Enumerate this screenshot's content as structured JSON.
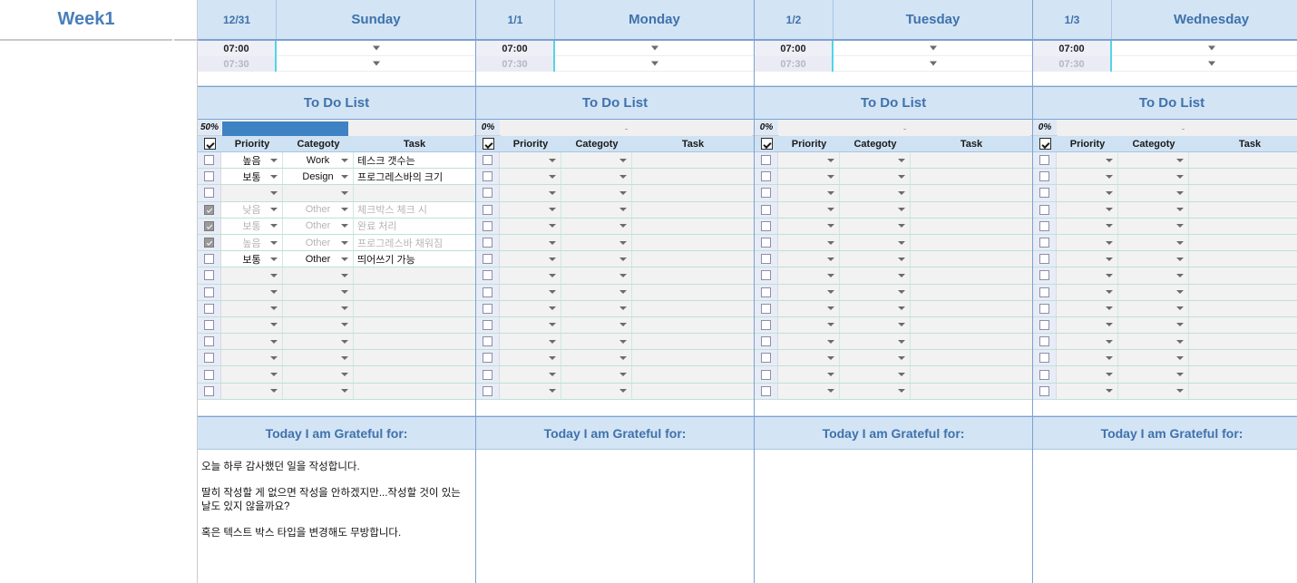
{
  "week": {
    "label": "Week1"
  },
  "columns": {
    "priority_header": "Priority",
    "category_header": "Categoty",
    "task_header": "Task"
  },
  "sections": {
    "todo_title": "To Do List",
    "grateful_title": "Today I am Grateful for:"
  },
  "time_rows": [
    {
      "label": "07:00"
    },
    {
      "label": "07:30"
    }
  ],
  "days": [
    {
      "date": "12/31",
      "name": "Sunday",
      "progress_pct": "50%",
      "progress_value": 50,
      "tasks": [
        {
          "checked": false,
          "priority": "높음",
          "category": "Work",
          "task": "테스크 갯수는",
          "dim": false
        },
        {
          "checked": false,
          "priority": "보통",
          "category": "Design",
          "task": "프로그레스바의 크기",
          "dim": false
        },
        {
          "checked": false,
          "priority": "",
          "category": "",
          "task": "",
          "dim": false
        },
        {
          "checked": true,
          "priority": "낮음",
          "category": "Other",
          "task": "체크박스 체크 시",
          "dim": true
        },
        {
          "checked": true,
          "priority": "보통",
          "category": "Other",
          "task": "완료 처리",
          "dim": true
        },
        {
          "checked": true,
          "priority": "높음",
          "category": "Other",
          "task": "프로그레스바 채워짐",
          "dim": true
        },
        {
          "checked": false,
          "priority": "보통",
          "category": "Other",
          "task": "띄어쓰기 가능",
          "dim": false
        },
        {
          "checked": false,
          "priority": "",
          "category": "",
          "task": "",
          "dim": false
        },
        {
          "checked": false,
          "priority": "",
          "category": "",
          "task": "",
          "dim": false
        },
        {
          "checked": false,
          "priority": "",
          "category": "",
          "task": "",
          "dim": false
        },
        {
          "checked": false,
          "priority": "",
          "category": "",
          "task": "",
          "dim": false
        },
        {
          "checked": false,
          "priority": "",
          "category": "",
          "task": "",
          "dim": false
        },
        {
          "checked": false,
          "priority": "",
          "category": "",
          "task": "",
          "dim": false
        },
        {
          "checked": false,
          "priority": "",
          "category": "",
          "task": "",
          "dim": false
        },
        {
          "checked": false,
          "priority": "",
          "category": "",
          "task": "",
          "dim": false
        }
      ],
      "grateful": [
        "오늘 하루 감사했던 일을 작성합니다.",
        "딸히 작성할 게 없으면 작성을 안하겠지만...작성할 것이 있는 날도 있지 않을까요?",
        "혹은 텍스트 박스 타입을 변경해도 무방합니다."
      ]
    },
    {
      "date": "1/1",
      "name": "Monday",
      "progress_pct": "0%",
      "progress_value": 0,
      "tasks": [
        {
          "checked": false,
          "priority": "",
          "category": "",
          "task": "",
          "dim": false
        },
        {
          "checked": false,
          "priority": "",
          "category": "",
          "task": "",
          "dim": false
        },
        {
          "checked": false,
          "priority": "",
          "category": "",
          "task": "",
          "dim": false
        },
        {
          "checked": false,
          "priority": "",
          "category": "",
          "task": "",
          "dim": false
        },
        {
          "checked": false,
          "priority": "",
          "category": "",
          "task": "",
          "dim": false
        },
        {
          "checked": false,
          "priority": "",
          "category": "",
          "task": "",
          "dim": false
        },
        {
          "checked": false,
          "priority": "",
          "category": "",
          "task": "",
          "dim": false
        },
        {
          "checked": false,
          "priority": "",
          "category": "",
          "task": "",
          "dim": false
        },
        {
          "checked": false,
          "priority": "",
          "category": "",
          "task": "",
          "dim": false
        },
        {
          "checked": false,
          "priority": "",
          "category": "",
          "task": "",
          "dim": false
        },
        {
          "checked": false,
          "priority": "",
          "category": "",
          "task": "",
          "dim": false
        },
        {
          "checked": false,
          "priority": "",
          "category": "",
          "task": "",
          "dim": false
        },
        {
          "checked": false,
          "priority": "",
          "category": "",
          "task": "",
          "dim": false
        },
        {
          "checked": false,
          "priority": "",
          "category": "",
          "task": "",
          "dim": false
        },
        {
          "checked": false,
          "priority": "",
          "category": "",
          "task": "",
          "dim": false
        }
      ],
      "grateful": []
    },
    {
      "date": "1/2",
      "name": "Tuesday",
      "progress_pct": "0%",
      "progress_value": 0,
      "tasks": [
        {
          "checked": false,
          "priority": "",
          "category": "",
          "task": "",
          "dim": false
        },
        {
          "checked": false,
          "priority": "",
          "category": "",
          "task": "",
          "dim": false
        },
        {
          "checked": false,
          "priority": "",
          "category": "",
          "task": "",
          "dim": false
        },
        {
          "checked": false,
          "priority": "",
          "category": "",
          "task": "",
          "dim": false
        },
        {
          "checked": false,
          "priority": "",
          "category": "",
          "task": "",
          "dim": false
        },
        {
          "checked": false,
          "priority": "",
          "category": "",
          "task": "",
          "dim": false
        },
        {
          "checked": false,
          "priority": "",
          "category": "",
          "task": "",
          "dim": false
        },
        {
          "checked": false,
          "priority": "",
          "category": "",
          "task": "",
          "dim": false
        },
        {
          "checked": false,
          "priority": "",
          "category": "",
          "task": "",
          "dim": false
        },
        {
          "checked": false,
          "priority": "",
          "category": "",
          "task": "",
          "dim": false
        },
        {
          "checked": false,
          "priority": "",
          "category": "",
          "task": "",
          "dim": false
        },
        {
          "checked": false,
          "priority": "",
          "category": "",
          "task": "",
          "dim": false
        },
        {
          "checked": false,
          "priority": "",
          "category": "",
          "task": "",
          "dim": false
        },
        {
          "checked": false,
          "priority": "",
          "category": "",
          "task": "",
          "dim": false
        },
        {
          "checked": false,
          "priority": "",
          "category": "",
          "task": "",
          "dim": false
        }
      ],
      "grateful": []
    },
    {
      "date": "1/3",
      "name": "Wednesday",
      "progress_pct": "0%",
      "progress_value": 0,
      "tasks": [
        {
          "checked": false,
          "priority": "",
          "category": "",
          "task": "",
          "dim": false
        },
        {
          "checked": false,
          "priority": "",
          "category": "",
          "task": "",
          "dim": false
        },
        {
          "checked": false,
          "priority": "",
          "category": "",
          "task": "",
          "dim": false
        },
        {
          "checked": false,
          "priority": "",
          "category": "",
          "task": "",
          "dim": false
        },
        {
          "checked": false,
          "priority": "",
          "category": "",
          "task": "",
          "dim": false
        },
        {
          "checked": false,
          "priority": "",
          "category": "",
          "task": "",
          "dim": false
        },
        {
          "checked": false,
          "priority": "",
          "category": "",
          "task": "",
          "dim": false
        },
        {
          "checked": false,
          "priority": "",
          "category": "",
          "task": "",
          "dim": false
        },
        {
          "checked": false,
          "priority": "",
          "category": "",
          "task": "",
          "dim": false
        },
        {
          "checked": false,
          "priority": "",
          "category": "",
          "task": "",
          "dim": false
        },
        {
          "checked": false,
          "priority": "",
          "category": "",
          "task": "",
          "dim": false
        },
        {
          "checked": false,
          "priority": "",
          "category": "",
          "task": "",
          "dim": false
        },
        {
          "checked": false,
          "priority": "",
          "category": "",
          "task": "",
          "dim": false
        },
        {
          "checked": false,
          "priority": "",
          "category": "",
          "task": "",
          "dim": false
        },
        {
          "checked": false,
          "priority": "",
          "category": "",
          "task": "",
          "dim": false
        }
      ],
      "grateful": []
    }
  ]
}
